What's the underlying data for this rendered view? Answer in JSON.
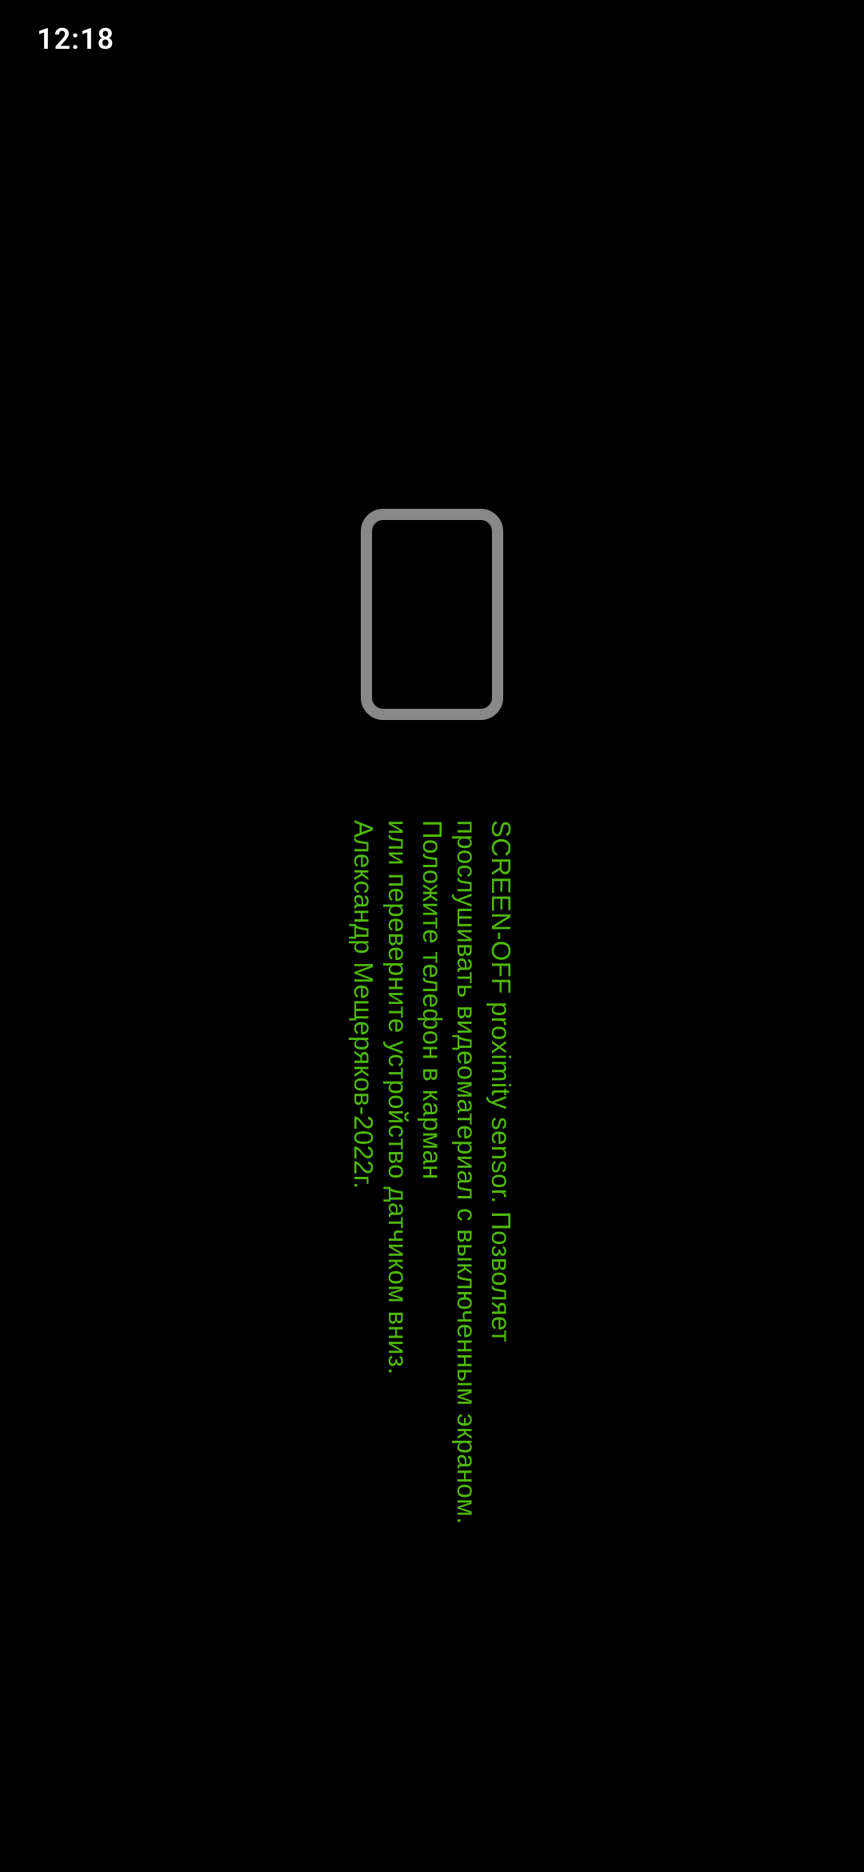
{
  "status_bar": {
    "time": "12:18"
  },
  "content": {
    "line1": "SCREEN-OFF  proximity sensor. Позволяет",
    "line2": "прослушивать видеоматериал с выключенным экраном.",
    "line3": "Положите телефон в карман",
    "line4": "или переверните устройство датчиком вниз.",
    "line5": "Александр Мещеряков-2022г."
  },
  "colors": {
    "text_green": "#4fb80a",
    "icon_gray": "#888888",
    "background": "#000000"
  }
}
